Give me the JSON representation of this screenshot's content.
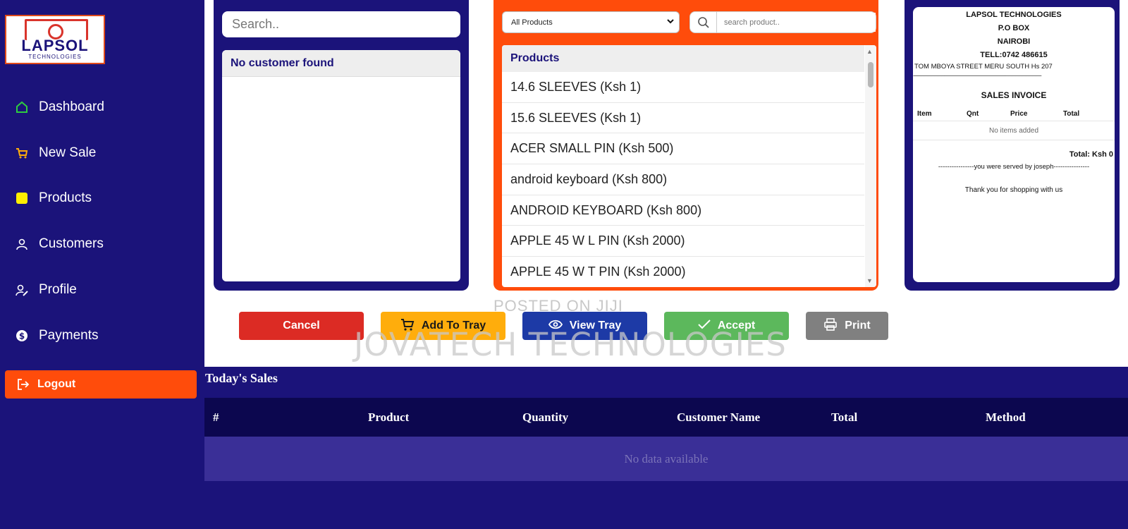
{
  "brand": {
    "logo_text": "LAPSOL",
    "logo_sub": "TECHNOLOGIES"
  },
  "sidebar": {
    "items": [
      {
        "label": "Dashboard",
        "icon": "home-icon"
      },
      {
        "label": "New Sale",
        "icon": "cart-icon"
      },
      {
        "label": "Products",
        "icon": "product-square-icon"
      },
      {
        "label": "Customers",
        "icon": "person-icon"
      },
      {
        "label": "Profile",
        "icon": "user-edit-icon"
      },
      {
        "label": "Payments",
        "icon": "dollar-icon"
      }
    ],
    "logout_label": "Logout"
  },
  "customers": {
    "search_placeholder": "Search..",
    "empty_message": "No customer found"
  },
  "products": {
    "category_selected": "All Products",
    "search_placeholder": "search product..",
    "list_header": "Products",
    "items": [
      "14.6 SLEEVES (Ksh 1)",
      "15.6 SLEEVES (Ksh 1)",
      "ACER SMALL PIN (Ksh 500)",
      "android keyboard (Ksh 800)",
      "ANDROID KEYBOARD (Ksh 800)",
      "APPLE 45 W L PIN (Ksh 2000)",
      "APPLE 45 W T PIN (Ksh 2000)"
    ]
  },
  "receipt": {
    "company": "LAPSOL TECHNOLOGIES",
    "po_box": "P.O BOX",
    "city": "NAIROBI",
    "tel": "TELL:0742 486615",
    "address": "TOM MBOYA STREET MERU SOUTH Hs 207",
    "divider": "-------------------------------------------------------------------------------------------",
    "title": "SALES INVOICE",
    "columns": [
      "Item",
      "Qnt",
      "Price",
      "Total"
    ],
    "empty_message": "No items added",
    "total": "Total: Ksh 0",
    "served_by": "----------------you were served by joseph----------------",
    "thanks": "Thank you for shopping with us"
  },
  "actions": {
    "cancel": "Cancel",
    "add_to_tray": "Add To Tray",
    "view_tray": "View Tray",
    "accept": "Accept",
    "print": "Print"
  },
  "sales": {
    "title": "Today's Sales",
    "columns": [
      "#",
      "Product",
      "Quantity",
      "Customer Name",
      "Total",
      "Method"
    ],
    "empty_message": "No data available"
  },
  "watermarks": {
    "posted": "POSTED ON JIJI",
    "owner": "JOVATECH TECHNOLOGIES"
  },
  "colors": {
    "sidebar_bg": "#1b137a",
    "accent_orange": "#ff4c0b",
    "active_nav": "#5e6a7e",
    "cancel": "#dc2b24",
    "add": "#ffad0c",
    "view": "#1d3aa6",
    "accept": "#5cb85c",
    "print": "#808080"
  }
}
